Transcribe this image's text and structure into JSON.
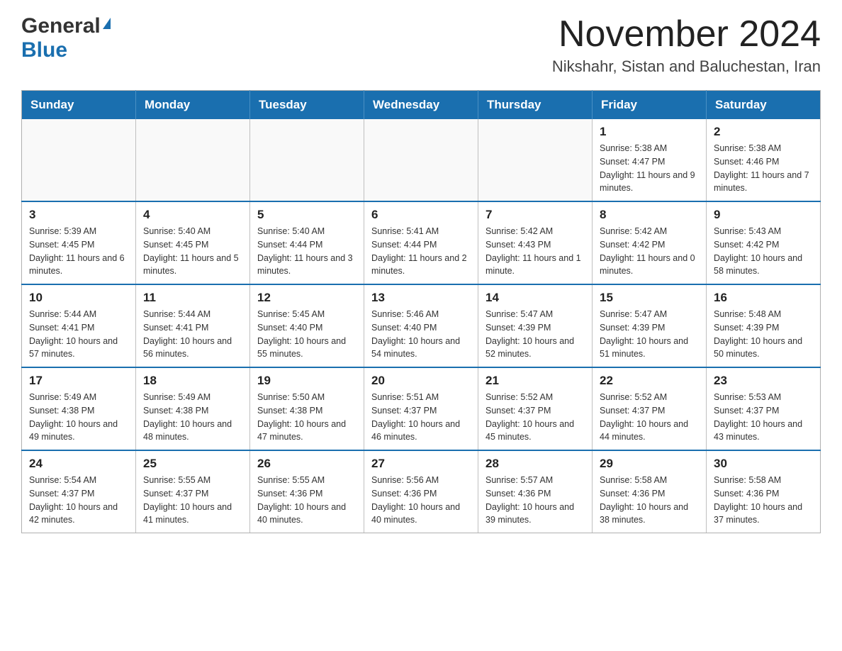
{
  "header": {
    "logo_line1": "General",
    "logo_line2": "Blue",
    "month_title": "November 2024",
    "location": "Nikshahr, Sistan and Baluchestan, Iran"
  },
  "weekdays": [
    "Sunday",
    "Monday",
    "Tuesday",
    "Wednesday",
    "Thursday",
    "Friday",
    "Saturday"
  ],
  "rows": [
    [
      {
        "day": "",
        "sunrise": "",
        "sunset": "",
        "daylight": ""
      },
      {
        "day": "",
        "sunrise": "",
        "sunset": "",
        "daylight": ""
      },
      {
        "day": "",
        "sunrise": "",
        "sunset": "",
        "daylight": ""
      },
      {
        "day": "",
        "sunrise": "",
        "sunset": "",
        "daylight": ""
      },
      {
        "day": "",
        "sunrise": "",
        "sunset": "",
        "daylight": ""
      },
      {
        "day": "1",
        "sunrise": "Sunrise: 5:38 AM",
        "sunset": "Sunset: 4:47 PM",
        "daylight": "Daylight: 11 hours and 9 minutes."
      },
      {
        "day": "2",
        "sunrise": "Sunrise: 5:38 AM",
        "sunset": "Sunset: 4:46 PM",
        "daylight": "Daylight: 11 hours and 7 minutes."
      }
    ],
    [
      {
        "day": "3",
        "sunrise": "Sunrise: 5:39 AM",
        "sunset": "Sunset: 4:45 PM",
        "daylight": "Daylight: 11 hours and 6 minutes."
      },
      {
        "day": "4",
        "sunrise": "Sunrise: 5:40 AM",
        "sunset": "Sunset: 4:45 PM",
        "daylight": "Daylight: 11 hours and 5 minutes."
      },
      {
        "day": "5",
        "sunrise": "Sunrise: 5:40 AM",
        "sunset": "Sunset: 4:44 PM",
        "daylight": "Daylight: 11 hours and 3 minutes."
      },
      {
        "day": "6",
        "sunrise": "Sunrise: 5:41 AM",
        "sunset": "Sunset: 4:44 PM",
        "daylight": "Daylight: 11 hours and 2 minutes."
      },
      {
        "day": "7",
        "sunrise": "Sunrise: 5:42 AM",
        "sunset": "Sunset: 4:43 PM",
        "daylight": "Daylight: 11 hours and 1 minute."
      },
      {
        "day": "8",
        "sunrise": "Sunrise: 5:42 AM",
        "sunset": "Sunset: 4:42 PM",
        "daylight": "Daylight: 11 hours and 0 minutes."
      },
      {
        "day": "9",
        "sunrise": "Sunrise: 5:43 AM",
        "sunset": "Sunset: 4:42 PM",
        "daylight": "Daylight: 10 hours and 58 minutes."
      }
    ],
    [
      {
        "day": "10",
        "sunrise": "Sunrise: 5:44 AM",
        "sunset": "Sunset: 4:41 PM",
        "daylight": "Daylight: 10 hours and 57 minutes."
      },
      {
        "day": "11",
        "sunrise": "Sunrise: 5:44 AM",
        "sunset": "Sunset: 4:41 PM",
        "daylight": "Daylight: 10 hours and 56 minutes."
      },
      {
        "day": "12",
        "sunrise": "Sunrise: 5:45 AM",
        "sunset": "Sunset: 4:40 PM",
        "daylight": "Daylight: 10 hours and 55 minutes."
      },
      {
        "day": "13",
        "sunrise": "Sunrise: 5:46 AM",
        "sunset": "Sunset: 4:40 PM",
        "daylight": "Daylight: 10 hours and 54 minutes."
      },
      {
        "day": "14",
        "sunrise": "Sunrise: 5:47 AM",
        "sunset": "Sunset: 4:39 PM",
        "daylight": "Daylight: 10 hours and 52 minutes."
      },
      {
        "day": "15",
        "sunrise": "Sunrise: 5:47 AM",
        "sunset": "Sunset: 4:39 PM",
        "daylight": "Daylight: 10 hours and 51 minutes."
      },
      {
        "day": "16",
        "sunrise": "Sunrise: 5:48 AM",
        "sunset": "Sunset: 4:39 PM",
        "daylight": "Daylight: 10 hours and 50 minutes."
      }
    ],
    [
      {
        "day": "17",
        "sunrise": "Sunrise: 5:49 AM",
        "sunset": "Sunset: 4:38 PM",
        "daylight": "Daylight: 10 hours and 49 minutes."
      },
      {
        "day": "18",
        "sunrise": "Sunrise: 5:49 AM",
        "sunset": "Sunset: 4:38 PM",
        "daylight": "Daylight: 10 hours and 48 minutes."
      },
      {
        "day": "19",
        "sunrise": "Sunrise: 5:50 AM",
        "sunset": "Sunset: 4:38 PM",
        "daylight": "Daylight: 10 hours and 47 minutes."
      },
      {
        "day": "20",
        "sunrise": "Sunrise: 5:51 AM",
        "sunset": "Sunset: 4:37 PM",
        "daylight": "Daylight: 10 hours and 46 minutes."
      },
      {
        "day": "21",
        "sunrise": "Sunrise: 5:52 AM",
        "sunset": "Sunset: 4:37 PM",
        "daylight": "Daylight: 10 hours and 45 minutes."
      },
      {
        "day": "22",
        "sunrise": "Sunrise: 5:52 AM",
        "sunset": "Sunset: 4:37 PM",
        "daylight": "Daylight: 10 hours and 44 minutes."
      },
      {
        "day": "23",
        "sunrise": "Sunrise: 5:53 AM",
        "sunset": "Sunset: 4:37 PM",
        "daylight": "Daylight: 10 hours and 43 minutes."
      }
    ],
    [
      {
        "day": "24",
        "sunrise": "Sunrise: 5:54 AM",
        "sunset": "Sunset: 4:37 PM",
        "daylight": "Daylight: 10 hours and 42 minutes."
      },
      {
        "day": "25",
        "sunrise": "Sunrise: 5:55 AM",
        "sunset": "Sunset: 4:37 PM",
        "daylight": "Daylight: 10 hours and 41 minutes."
      },
      {
        "day": "26",
        "sunrise": "Sunrise: 5:55 AM",
        "sunset": "Sunset: 4:36 PM",
        "daylight": "Daylight: 10 hours and 40 minutes."
      },
      {
        "day": "27",
        "sunrise": "Sunrise: 5:56 AM",
        "sunset": "Sunset: 4:36 PM",
        "daylight": "Daylight: 10 hours and 40 minutes."
      },
      {
        "day": "28",
        "sunrise": "Sunrise: 5:57 AM",
        "sunset": "Sunset: 4:36 PM",
        "daylight": "Daylight: 10 hours and 39 minutes."
      },
      {
        "day": "29",
        "sunrise": "Sunrise: 5:58 AM",
        "sunset": "Sunset: 4:36 PM",
        "daylight": "Daylight: 10 hours and 38 minutes."
      },
      {
        "day": "30",
        "sunrise": "Sunrise: 5:58 AM",
        "sunset": "Sunset: 4:36 PM",
        "daylight": "Daylight: 10 hours and 37 minutes."
      }
    ]
  ]
}
